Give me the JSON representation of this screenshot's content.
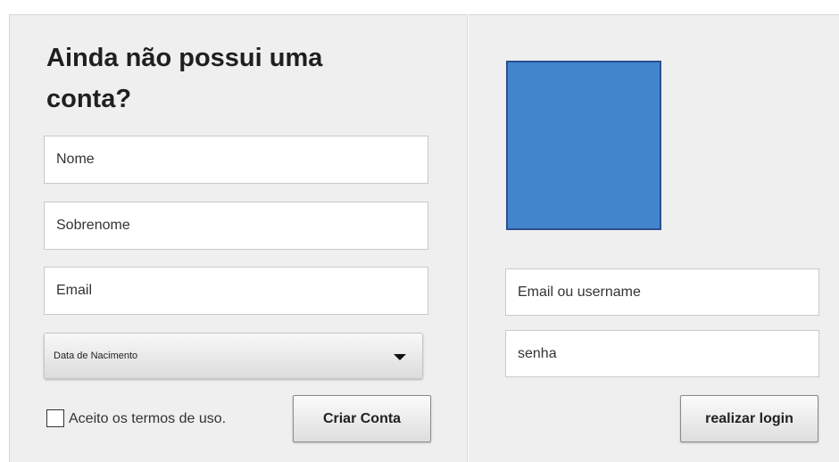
{
  "signup": {
    "title": "Ainda não possui uma conta?",
    "name_placeholder": "Nome",
    "surname_placeholder": "Sobrenome",
    "email_placeholder": "Email",
    "birthdate_label": "Data de Nacimento",
    "terms_label": "Aceito os termos de uso.",
    "create_button": "Criar Conta"
  },
  "login": {
    "user_placeholder": "Email ou username",
    "password_placeholder": "senha",
    "login_button": "realizar login"
  },
  "colors": {
    "logo_fill": "#4285cc",
    "logo_border": "#2a4f90"
  }
}
